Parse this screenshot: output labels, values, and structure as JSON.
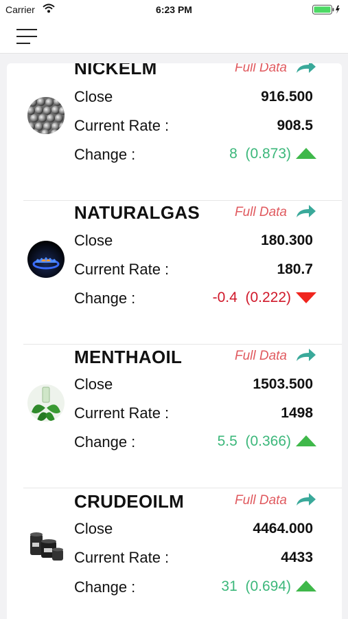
{
  "status_bar": {
    "carrier": "Carrier",
    "time": "6:23 PM"
  },
  "colors": {
    "up": "#3bb77a",
    "down": "#d0182a",
    "full_data": "#e05a5f",
    "share_arrow": "#3aa99a"
  },
  "commodities": [
    {
      "name": "NICKELM",
      "icon": "nickel-balls-icon",
      "full_data": "Full Data",
      "close_label": "Close",
      "close": "916.500",
      "rate_label": "Current Rate :",
      "rate": "908.5",
      "change_label": "Change :",
      "change": "8",
      "change_pct": "(0.873)",
      "direction": "up"
    },
    {
      "name": "NATURALGAS",
      "icon": "gas-flame-icon",
      "full_data": "Full Data",
      "close_label": "Close",
      "close": "180.300",
      "rate_label": "Current Rate :",
      "rate": "180.7",
      "change_label": "Change :",
      "change": "-0.4",
      "change_pct": "(0.222)",
      "direction": "down"
    },
    {
      "name": "MENTHAOIL",
      "icon": "mint-leaves-icon",
      "full_data": "Full Data",
      "close_label": "Close",
      "close": "1503.500",
      "rate_label": "Current Rate :",
      "rate": "1498",
      "change_label": "Change :",
      "change": "5.5",
      "change_pct": "(0.366)",
      "direction": "up"
    },
    {
      "name": "CRUDEOILM",
      "icon": "oil-barrels-icon",
      "full_data": "Full Data",
      "close_label": "Close",
      "close": "4464.000",
      "rate_label": "Current Rate :",
      "rate": "4433",
      "change_label": "Change :",
      "change": "31",
      "change_pct": "(0.694)",
      "direction": "up"
    }
  ]
}
